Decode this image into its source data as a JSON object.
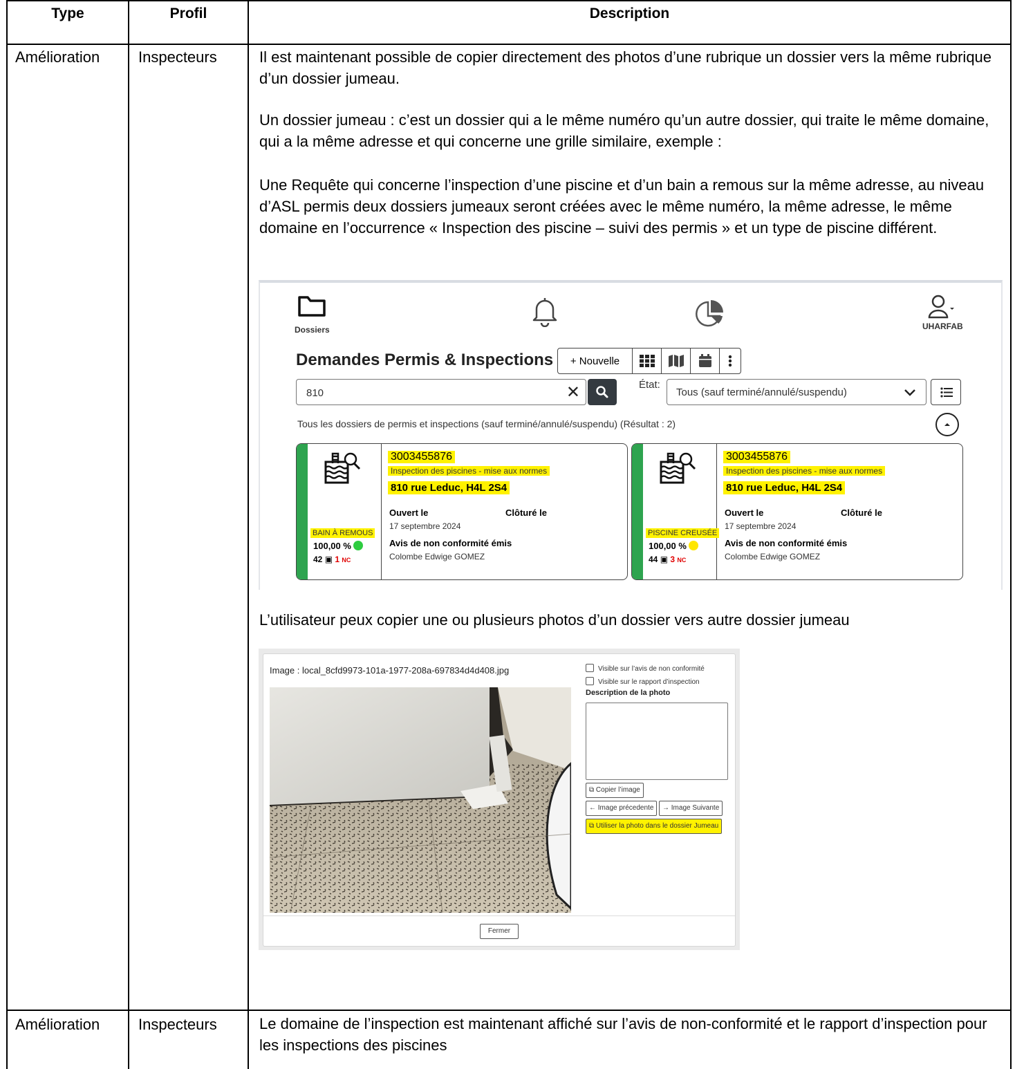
{
  "table": {
    "headers": {
      "type": "Type",
      "profil": "Profil",
      "description": "Description"
    },
    "rows": [
      {
        "type": "Amélioration",
        "profil": "Inspecteurs",
        "paragraphs": [
          "Il est maintenant possible de copier directement des photos d’une rubrique un dossier vers la même rubrique d’un dossier jumeau.",
          "Un dossier jumeau : c’est un dossier qui a le même numéro qu’un autre dossier, qui traite le même domaine, qui a la même adresse et qui concerne une grille similaire, exemple :",
          "Une Requête qui concerne l’inspection d’une piscine et d’un bain a remous sur la même adresse, au niveau d’ASL permis deux dossiers jumeaux seront créées avec le même numéro, la même adresse, le même domaine en l’occurrence « Inspection des piscine – suivi des permis » et un type de piscine différent.",
          "L’utilisateur peux copier une ou plusieurs photos d’un dossier vers autre dossier jumeau"
        ]
      },
      {
        "type": "Amélioration",
        "profil": "Inspecteurs",
        "paragraphs": [
          "Le domaine de l’inspection est maintenant affiché sur l’avis de non-conformité et le rapport d’inspection pour les inspections des piscines"
        ]
      }
    ]
  },
  "app": {
    "nav": {
      "dossiers": "Dossiers",
      "user": "UHARFAB"
    },
    "title": "Demandes Permis & Inspections",
    "new_button": "+ Nouvelle",
    "search_value": "810",
    "etat_label": "État:",
    "etat_value": "Tous (sauf terminé/annulé/suspendu)",
    "result_text": "Tous les dossiers de permis et inspections (sauf terminé/annulé/suspendu) (Résultat : 2)",
    "cards": [
      {
        "number": "3003455876",
        "domain": "Inspection des piscines - mise aux normes",
        "address": "810 rue Leduc, H4L 2S4",
        "opened_label": "Ouvert le",
        "closed_label": "Clôturé le",
        "opened_date": "17 septembre 2024",
        "avis": "Avis de non conformité émis",
        "inspector": "Colombe Edwige GOMEZ",
        "pool_type": "BAIN À REMOUS",
        "percent": "100,00 %",
        "status_color": "#2ecc40",
        "photos": "42",
        "nc_count": "1",
        "nc_label": "NC"
      },
      {
        "number": "3003455876",
        "domain": "Inspection des piscines - mise aux normes",
        "address": "810 rue Leduc, H4L 2S4",
        "opened_label": "Ouvert le",
        "closed_label": "Clôturé le",
        "opened_date": "17 septembre 2024",
        "avis": "Avis de non conformité émis",
        "inspector": "Colombe Edwige GOMEZ",
        "pool_type": "PISCINE CREUSÉE",
        "percent": "100,00 %",
        "status_color": "#ffe600",
        "photos": "44",
        "nc_count": "3",
        "nc_label": "NC"
      }
    ]
  },
  "photo_dialog": {
    "title": "Image : local_8cfd9973-101a-1977-208a-697834d4d408.jpg",
    "checkbox_avis": "Visible sur l’avis de non conformité",
    "checkbox_rapport": "Visible sur le rapport d’inspection",
    "description_label": "Description de la photo",
    "copy_button": "Copier l’image",
    "prev_button": "← Image précedente",
    "next_button": "→ Image Suivante",
    "twin_button": "Utiliser la photo dans le dossier Jumeau",
    "close_button": "Fermer"
  }
}
